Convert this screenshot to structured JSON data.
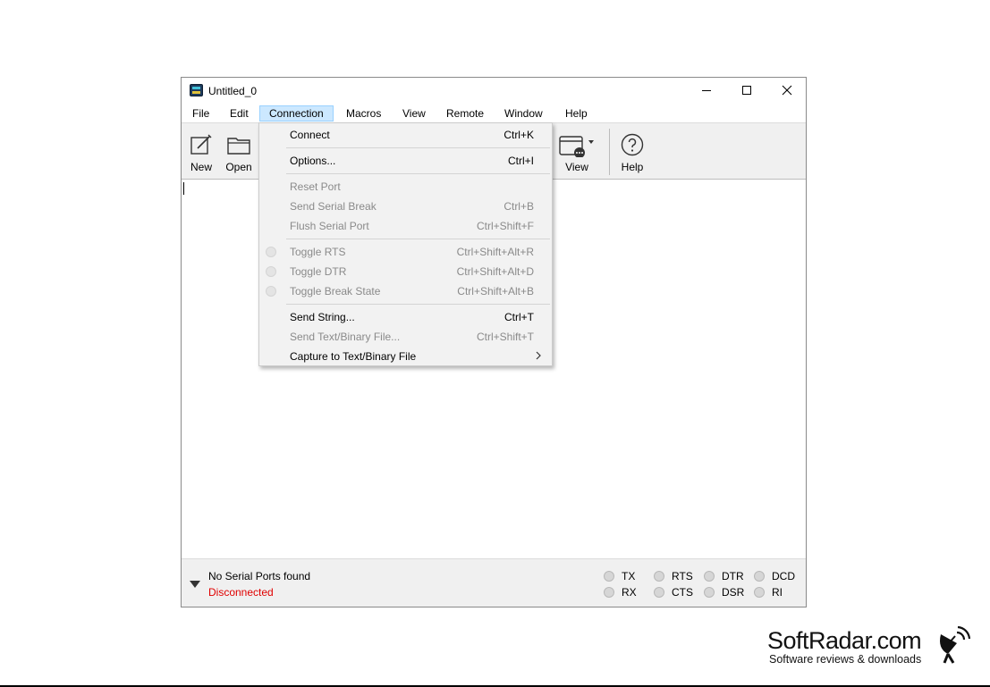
{
  "window": {
    "title": "Untitled_0"
  },
  "menubar": {
    "items": [
      "File",
      "Edit",
      "Connection",
      "Macros",
      "View",
      "Remote",
      "Window",
      "Help"
    ],
    "active": "Connection"
  },
  "toolbar": {
    "new_label": "New",
    "open_label": "Open",
    "view_label": "View",
    "help_label": "Help"
  },
  "dropdown": {
    "connect": {
      "label": "Connect",
      "shortcut": "Ctrl+K"
    },
    "options": {
      "label": "Options...",
      "shortcut": "Ctrl+I"
    },
    "reset_port": {
      "label": "Reset Port",
      "shortcut": ""
    },
    "send_serial_break": {
      "label": "Send Serial Break",
      "shortcut": "Ctrl+B"
    },
    "flush_serial_port": {
      "label": "Flush Serial Port",
      "shortcut": "Ctrl+Shift+F"
    },
    "toggle_rts": {
      "label": "Toggle RTS",
      "shortcut": "Ctrl+Shift+Alt+R"
    },
    "toggle_dtr": {
      "label": "Toggle DTR",
      "shortcut": "Ctrl+Shift+Alt+D"
    },
    "toggle_break": {
      "label": "Toggle Break State",
      "shortcut": "Ctrl+Shift+Alt+B"
    },
    "send_string": {
      "label": "Send String...",
      "shortcut": "Ctrl+T"
    },
    "send_file": {
      "label": "Send Text/Binary File...",
      "shortcut": "Ctrl+Shift+T"
    },
    "capture": {
      "label": "Capture to Text/Binary File"
    }
  },
  "status": {
    "port": "No Serial Ports found",
    "connection": "Disconnected",
    "signals": {
      "tx": "TX",
      "rx": "RX",
      "rts": "RTS",
      "cts": "CTS",
      "dtr": "DTR",
      "dsr": "DSR",
      "dcd": "DCD",
      "ri": "RI"
    }
  },
  "watermark": {
    "title": "SoftRadar.com",
    "subtitle": "Software reviews & downloads"
  },
  "colors": {
    "disconnected": "#e00000",
    "menu_highlight": "#cce8ff",
    "toolbar_bg": "#f0f0f0"
  }
}
